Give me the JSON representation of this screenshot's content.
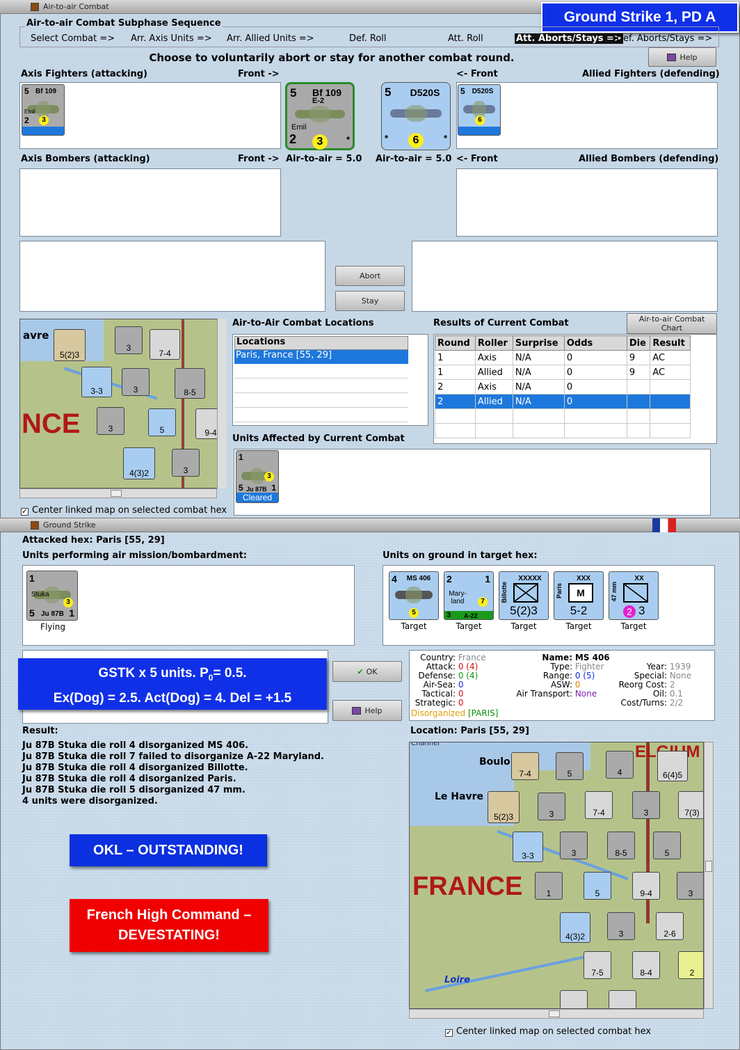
{
  "top_window": {
    "title": "Air-to-air Combat",
    "banner": "Ground Strike 1, PD A",
    "subphase_header": "Air-to-air Combat Subphase Sequence",
    "sequence": [
      "Select Combat =>",
      "Arr. Axis Units =>",
      "Arr. Allied Units =>",
      "Def. Roll",
      "Att. Roll",
      "Att. Aborts/Stays =>",
      "Def. Aborts/Stays =>"
    ],
    "active_step": "Att. Aborts/Stays =>",
    "prompt": "Choose to voluntarily abort or stay for another combat round.",
    "help_label": "Help",
    "axis_fighters_label": "Axis Fighters (attacking)",
    "front_right": "Front ->",
    "front_left": "<- Front",
    "allied_fighters_label": "Allied Fighters (defending)",
    "axis_bombers_label": "Axis Bombers (attacking)",
    "allied_bombers_label": "Allied Bombers (defending)",
    "axis_a2a": "Air-to-air = 5.0",
    "allied_a2a": "Air-to-air = 5.0",
    "axis_front_unit": {
      "range": "5",
      "name": "Bf 109",
      "sub": "E-2",
      "pilot": "Emil",
      "bottom": "2",
      "rating": "3",
      "star": "*"
    },
    "allied_front_unit": {
      "range": "5",
      "name": "D520S",
      "rating": "6",
      "star": "*"
    },
    "axis_small_unit": {
      "range": "5",
      "name": "Bf 109",
      "sub": "E-2",
      "pilot": "Emil",
      "bottom": "2",
      "rating": "3"
    },
    "allied_small_unit": {
      "range": "5",
      "name": "D520S",
      "rating": "6"
    },
    "abort_label": "Abort",
    "stay_label": "Stay",
    "locations_title": "Air-to-Air Combat Locations",
    "locations_header": "Locations",
    "locations": [
      "Paris, France [55, 29]"
    ],
    "results_title": "Results of Current Combat",
    "chart_button": "Air-to-air Combat Chart",
    "results_headers": [
      "Round",
      "Roller",
      "Surprise",
      "Odds",
      "Die",
      "Result"
    ],
    "results_rows": [
      [
        "1",
        "Axis",
        "N/A",
        "0",
        "9",
        "AC"
      ],
      [
        "1",
        "Allied",
        "N/A",
        "0",
        "9",
        "AC"
      ],
      [
        "2",
        "Axis",
        "N/A",
        "0",
        "",
        ""
      ],
      [
        "2",
        "Allied",
        "N/A",
        "0",
        "",
        ""
      ]
    ],
    "affected_title": "Units Affected by Current Combat",
    "affected_unit": {
      "top": "1",
      "bottom": "5",
      "name": "Ju 87B",
      "rating": "3",
      "right": "1",
      "status": "Cleared"
    },
    "center_map_label": "Center linked map on selected combat hex",
    "map_text": {
      "havre": "avre",
      "france": "NCE"
    }
  },
  "bottom_window": {
    "title": "Ground Strike",
    "attacked_hex": "Attacked hex: Paris  [55, 29]",
    "performing_label": "Units performing air mission/bombardment:",
    "ground_label": "Units on ground in target hex:",
    "stuka": {
      "top": "1",
      "name": "Stuka",
      "rating": "3",
      "bottom": "5",
      "type": "Ju 87B",
      "right": "1",
      "status": "Flying"
    },
    "targets": [
      {
        "top": "4",
        "name": "MS 406",
        "rating": "5",
        "caption": "Target"
      },
      {
        "top": "2",
        "name": "Mary-land",
        "rating": "7",
        "sub": "A-22",
        "right": "1",
        "bottom": "3",
        "caption": "Target"
      },
      {
        "top": "XXXXX",
        "name": "Billotte",
        "value": "5(2)3",
        "caption": "Target"
      },
      {
        "top": "XXX",
        "name": "Paris",
        "value": "5-2",
        "letter": "M",
        "caption": "Target"
      },
      {
        "top": "XX",
        "name": "47 mm",
        "value": "3",
        "rating": "2",
        "caption": "Target"
      }
    ],
    "ok_label": "OK",
    "help_label": "Help",
    "gstk_banner_line1": "GSTK x 5 units.  P",
    "gstk_sub": "0",
    "gstk_banner_line1b": "= 0.5.",
    "gstk_banner_line2": "Ex(Dog) = 2.5.  Act(Dog) = 4.  Del = +1.5",
    "info": {
      "country_k": "Country:",
      "country_v": "France",
      "attack_k": "Attack:",
      "attack_v": "0",
      "attack_x": "(4)",
      "defense_k": "Defense:",
      "defense_v": "0",
      "defense_x": "(4)",
      "airsea_k": "Air-Sea:",
      "airsea_v": "0",
      "tactical_k": "Tactical:",
      "tactical_v": "0",
      "strategic_k": "Strategic:",
      "strategic_v": "0",
      "status": "Disorganized",
      "status_loc": "[PARIS]",
      "name_k": "Name:",
      "name_v": "MS 406",
      "type_k": "Type:",
      "type_v": "Fighter",
      "range_k": "Range:",
      "range_v": "0",
      "range_x": "(5)",
      "asw_k": "ASW:",
      "asw_v": "0",
      "airtrans_k": "Air Transport:",
      "airtrans_v": "None",
      "year_k": "Year:",
      "year_v": "1939",
      "special_k": "Special:",
      "special_v": "None",
      "reorg_k": "Reorg Cost:",
      "reorg_v": "2",
      "oil_k": "Oil:",
      "oil_v": "0.1",
      "cost_k": "Cost/Turns:",
      "cost_v": "2/2"
    },
    "result_label": "Result:",
    "results": [
      "Ju 87B Stuka die roll 4 disorganized MS 406.",
      "Ju 87B Stuka die roll 7 failed to disorganize A-22 Maryland.",
      "Ju 87B Stuka die roll 4 disorganized Billotte.",
      "Ju 87B Stuka die roll 4 disorganized Paris.",
      "Ju 87B Stuka die roll 5 disorganized 47 mm.",
      "4 units were disorganized."
    ],
    "okl_banner": "OKL – OUTSTANDING!",
    "french_banner_line1": "French High Command –",
    "french_banner_line2": "DEVESTATING!",
    "location_label": "Location:  Paris  [55, 29]",
    "map_text": {
      "boulogne": "Boulo",
      "lehavre": "Le Havre",
      "france": "FRANCE",
      "belgium": "ELGIUM",
      "loire": "Loire",
      "channel": "Channel"
    },
    "center_map_label": "Center linked map on selected combat hex"
  },
  "colors": {
    "banner_blue": "#1030e8",
    "okl_blue": "#0a30e0",
    "french_red": "#f00000",
    "selected_row": "#1e78dc",
    "counter_axis": "#a9a9a9",
    "counter_allied": "#a9cdf0"
  }
}
